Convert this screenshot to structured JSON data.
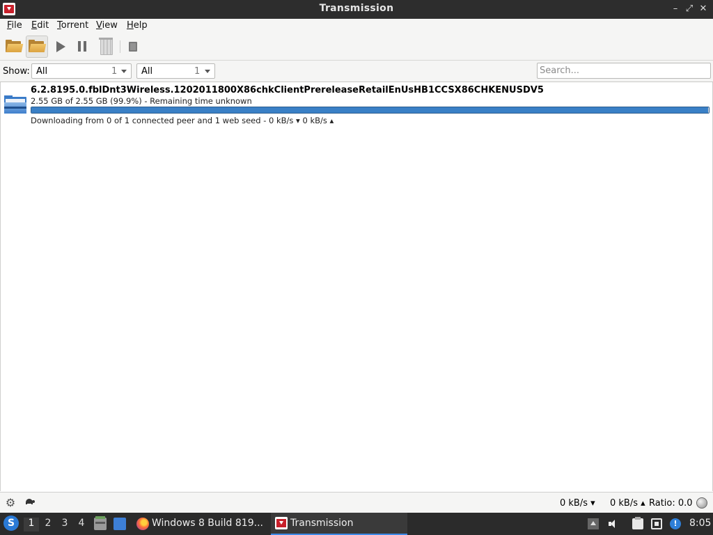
{
  "window": {
    "title": "Transmission",
    "controls": {
      "minimize": "–",
      "restore": "⤢",
      "close": "✕"
    }
  },
  "menu": [
    {
      "mnemonic": "F",
      "rest": "ile"
    },
    {
      "mnemonic": "E",
      "rest": "dit"
    },
    {
      "mnemonic": "T",
      "rest": "orrent"
    },
    {
      "mnemonic": "V",
      "rest": "iew"
    },
    {
      "mnemonic": "H",
      "rest": "elp"
    }
  ],
  "toolbar": {
    "icons": [
      "open-folder-icon",
      "open-url-folder-icon",
      "play-icon",
      "pause-icon",
      "trash-icon",
      "properties-icon"
    ]
  },
  "filter": {
    "show_label": "Show:",
    "activity": {
      "value": "All",
      "count": "1"
    },
    "tracker": {
      "value": "All",
      "count": "1"
    },
    "search_placeholder": "Search..."
  },
  "torrents": [
    {
      "name": "6.2.8195.0.fblDnt3Wireless.1202011800X86chkClientPrereleaseRetailEnUsHB1CCSX86CHKENUSDV5",
      "progress_text": "2.55 GB of 2.55 GB (99.9%) - Remaining time unknown",
      "progress": 0.999,
      "status": "Downloading from 0 of 1 connected peer and 1 web seed - 0 kB/s ▾   0 kB/s ▴",
      "bar_color": "#3a80c6"
    }
  ],
  "statusbar": {
    "down_speed": "0 kB/s ▾",
    "up_speed": "0 kB/s ▴",
    "ratio": "Ratio: 0.0"
  },
  "taskbar": {
    "workspaces": [
      "1",
      "2",
      "3",
      "4"
    ],
    "active_workspace": "1",
    "tasks": [
      {
        "label": "Windows 8 Build 819..."
      },
      {
        "label": "Transmission"
      }
    ],
    "clock": "8:05"
  }
}
